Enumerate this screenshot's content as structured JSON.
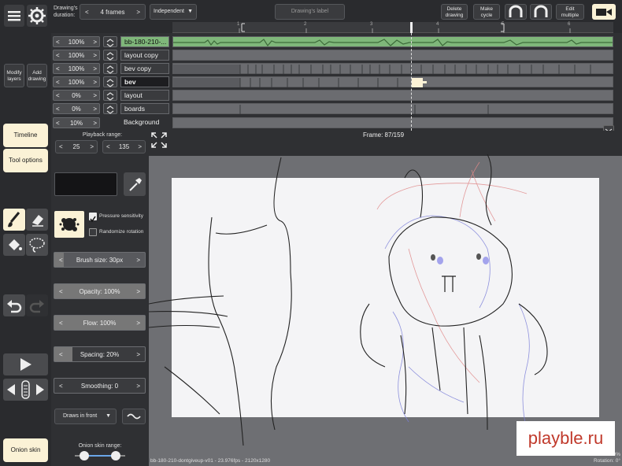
{
  "top": {
    "drawing_duration_label": "Drawing's duration:",
    "duration_value": "4 frames",
    "mode": "Independent",
    "label_placeholder": "Drawing's label",
    "delete_drawing": "Delete drawing",
    "make_cycle": "Make cycle",
    "edit_multiple": "Edit multiple",
    "ruler_ticks": [
      "1",
      "2",
      "3",
      "4",
      "5",
      "6"
    ]
  },
  "left_top": {
    "modify_layers": "Modify layers",
    "add_drawing": "Add drawing"
  },
  "layers": [
    {
      "opacity": "100%",
      "name": "bb-180-210-..."
    },
    {
      "opacity": "100%",
      "name": "layout copy"
    },
    {
      "opacity": "100%",
      "name": "bev copy"
    },
    {
      "opacity": "100%",
      "name": "bev"
    },
    {
      "opacity": "0%",
      "name": "layout"
    },
    {
      "opacity": "0%",
      "name": "boards"
    },
    {
      "opacity": "10%",
      "name": "Background"
    }
  ],
  "side": {
    "timeline": "Timeline",
    "tool_options": "Tool options",
    "onion_skin": "Onion skin"
  },
  "options": {
    "playback_label": "Playback range:",
    "range_start": "25",
    "range_end": "135",
    "pressure": "Pressure sensitivity",
    "randomize": "Randomize rotation",
    "brush_size": "Brush size: 30px",
    "opacity": "Opacity: 100%",
    "flow": "Flow: 100%",
    "spacing": "Spacing: 20%",
    "smoothing": "Smoothing: 0",
    "draws_in_front": "Draws in front",
    "onion_range": "Onion skin range:",
    "brush_color": "#141416"
  },
  "canvas": {
    "frame": "Frame: 87/159",
    "file_info": "bb-180-210-dontgiveup-v01 - 23.976fps - 2120x1280",
    "zoom": "Zoom: 70%",
    "rotation": "Rotation: 0°",
    "watermark": "playble.ru"
  },
  "colors": {
    "accent": "#fbf2d6",
    "waveform": "#7fb77a",
    "panel": "#2f3033"
  }
}
